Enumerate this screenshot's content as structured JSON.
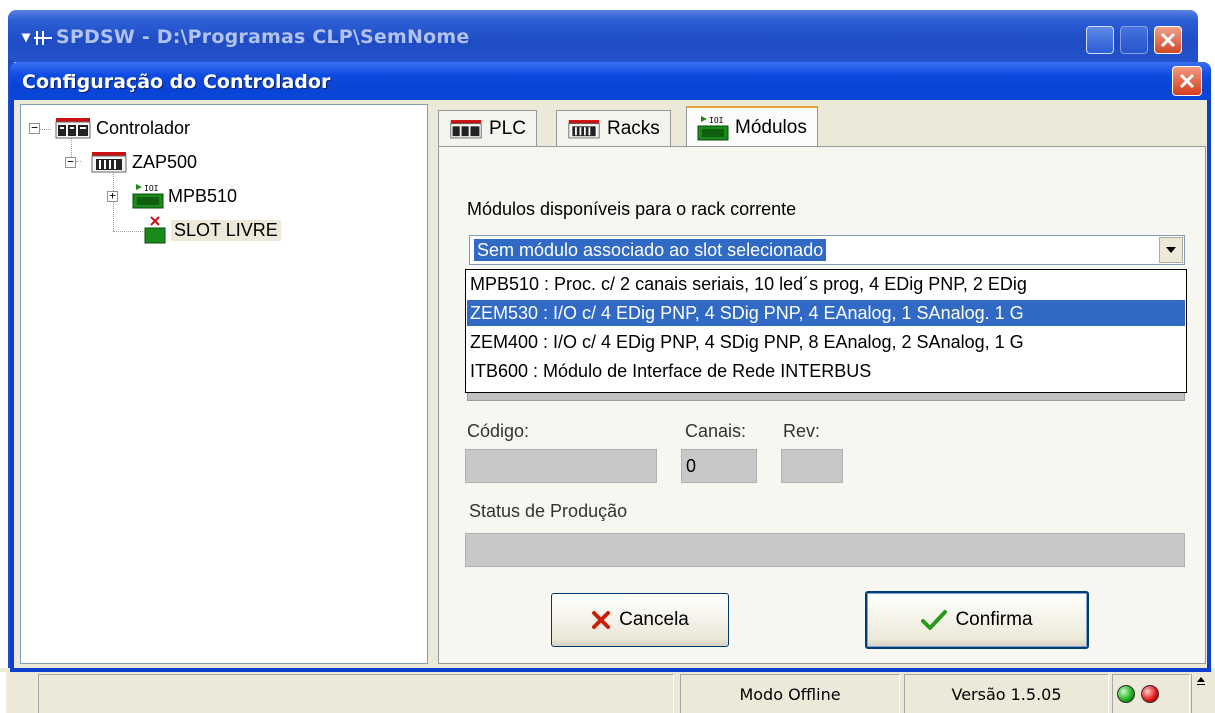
{
  "main_window": {
    "title": "SPDSW - D:\\Programas CLP\\SemNome",
    "system_menu_glyph": "▾"
  },
  "dialog": {
    "title": "Configuração do Controlador"
  },
  "tree": {
    "nodes": [
      {
        "label": "Controlador",
        "icon": "plc-icon",
        "expander": "−"
      },
      {
        "label": "ZAP500",
        "icon": "rack-icon",
        "expander": "−"
      },
      {
        "label": "MPB510",
        "icon": "module-icon",
        "expander": "+"
      },
      {
        "label": "SLOT LIVRE",
        "icon": "empty-slot-icon",
        "selected": true
      }
    ]
  },
  "tabs": [
    {
      "label": "PLC",
      "icon": "plc-icon",
      "active": false
    },
    {
      "label": "Racks",
      "icon": "rack-icon",
      "active": false
    },
    {
      "label": "Módulos",
      "icon": "module-icon",
      "active": true
    }
  ],
  "modules": {
    "available_label": "Módulos disponíveis para o rack corrente",
    "combo_value": "Sem módulo associado ao slot selecionado",
    "options": [
      {
        "text": "MPB510 : Proc. c/ 2 canais seriais, 10 led´s prog, 4 EDig PNP, 2 EDig",
        "selected": false
      },
      {
        "text": "ZEM530 : I/O c/ 4 EDig PNP, 4 SDig PNP, 4 EAnalog, 1 SAnalog. 1 G",
        "selected": true
      },
      {
        "text": "ZEM400 : I/O c/ 4 EDig PNP, 4 SDig PNP, 8 EAnalog, 2 SAnalog, 1 G",
        "selected": false
      },
      {
        "text": "ITB600 : Módulo de Interface de Rede INTERBUS",
        "selected": false
      }
    ],
    "codigo_label": "Código:",
    "codigo_value": "",
    "canais_label": "Canais:",
    "canais_value": "0",
    "rev_label": "Rev:",
    "rev_value": "",
    "status_label": "Status de Produção",
    "status_value": ""
  },
  "buttons": {
    "cancel_label": "Cancela",
    "confirm_label": "Confirma"
  },
  "statusbar": {
    "mode": "Modo Offline",
    "version": "Versão 1.5.05",
    "led_colors": [
      "#19a819",
      "#e01010"
    ]
  }
}
